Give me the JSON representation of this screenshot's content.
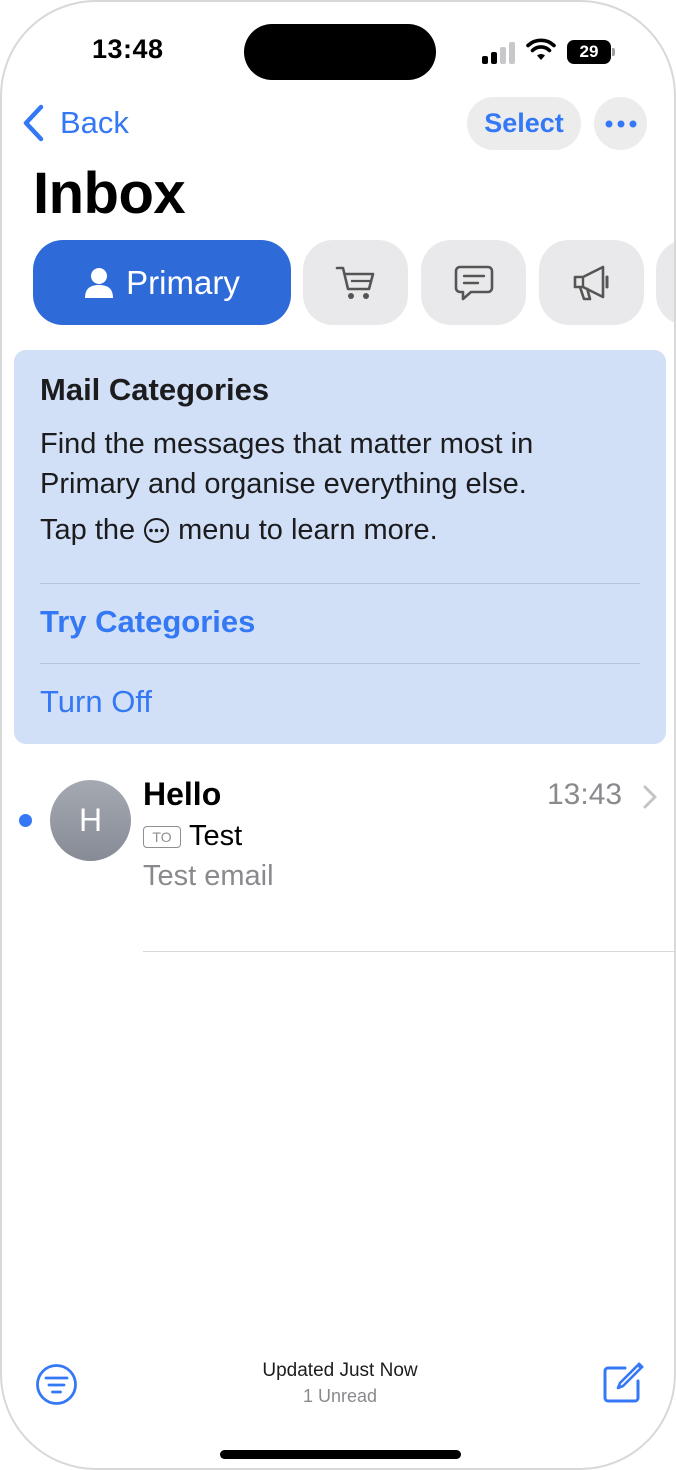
{
  "status_bar": {
    "time": "13:48",
    "battery_level": "29",
    "signal_bars_active": 2,
    "signal_bars_total": 4
  },
  "nav": {
    "back_label": "Back",
    "select_label": "Select",
    "more_icon": "ellipsis-icon"
  },
  "title": "Inbox",
  "tabs": [
    {
      "label": "Primary",
      "icon": "person-icon",
      "selected": true
    },
    {
      "label": "",
      "icon": "cart-icon",
      "selected": false
    },
    {
      "label": "",
      "icon": "message-bubble-icon",
      "selected": false
    },
    {
      "label": "",
      "icon": "megaphone-icon",
      "selected": false
    }
  ],
  "info_card": {
    "title": "Mail Categories",
    "body": "Find the messages that matter most in Primary and organise everything else.",
    "hint_before": "Tap the",
    "hint_after": "menu to learn more.",
    "try_label": "Try Categories",
    "off_label": "Turn Off"
  },
  "mails": [
    {
      "avatar_initial": "H",
      "sender": "Hello",
      "time": "13:43",
      "to_badge": "TO",
      "subject": "Test",
      "preview": "Test email",
      "unread": true
    }
  ],
  "toolbar": {
    "updated": "Updated Just Now",
    "unread_count": "1 Unread",
    "filter_icon": "filter-icon",
    "compose_icon": "compose-icon"
  },
  "colors": {
    "accent": "#3478f6",
    "primary_tab": "#2f6bd8",
    "card_bg": "#d1e0f6",
    "secondary_text": "#8a8a8e"
  }
}
